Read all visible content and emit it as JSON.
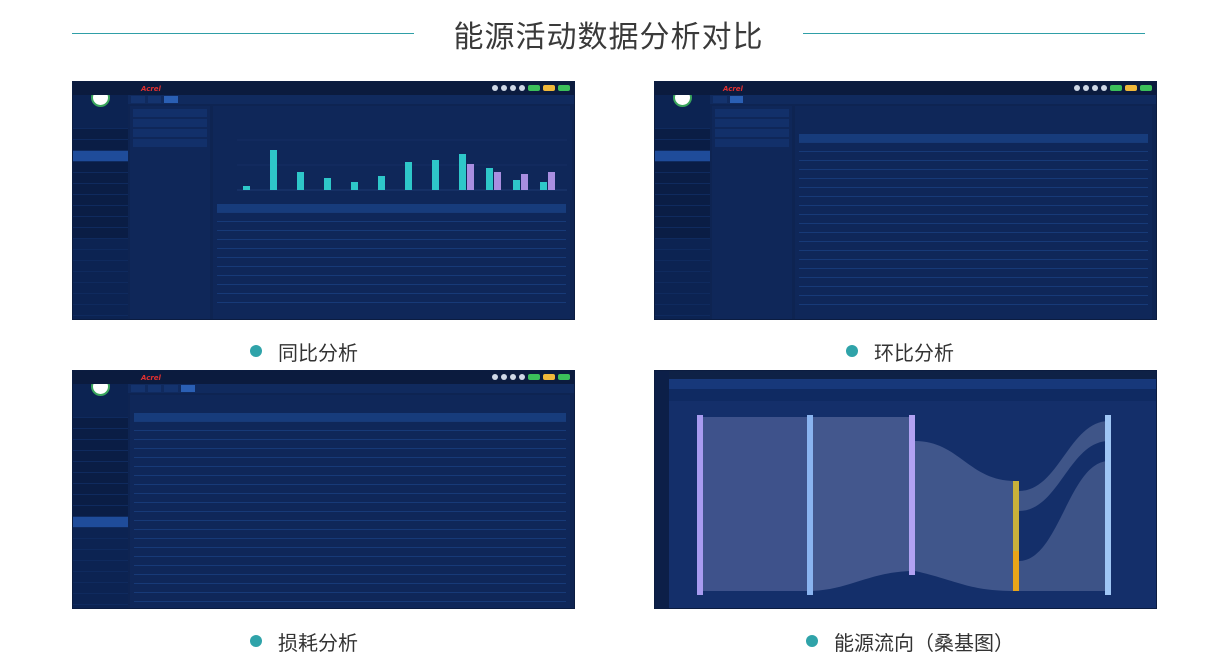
{
  "page": {
    "title": "能源活动数据分析对比"
  },
  "panels": [
    {
      "caption": "同比分析"
    },
    {
      "caption": "环比分析"
    },
    {
      "caption": "损耗分析"
    },
    {
      "caption": "能源流向（桑基图）"
    }
  ],
  "colors": {
    "accent": "#2fa3a9",
    "app_bg": "#0e2452",
    "bar_cyan": "#2ec7c9",
    "bar_purple": "#a98ee0"
  }
}
